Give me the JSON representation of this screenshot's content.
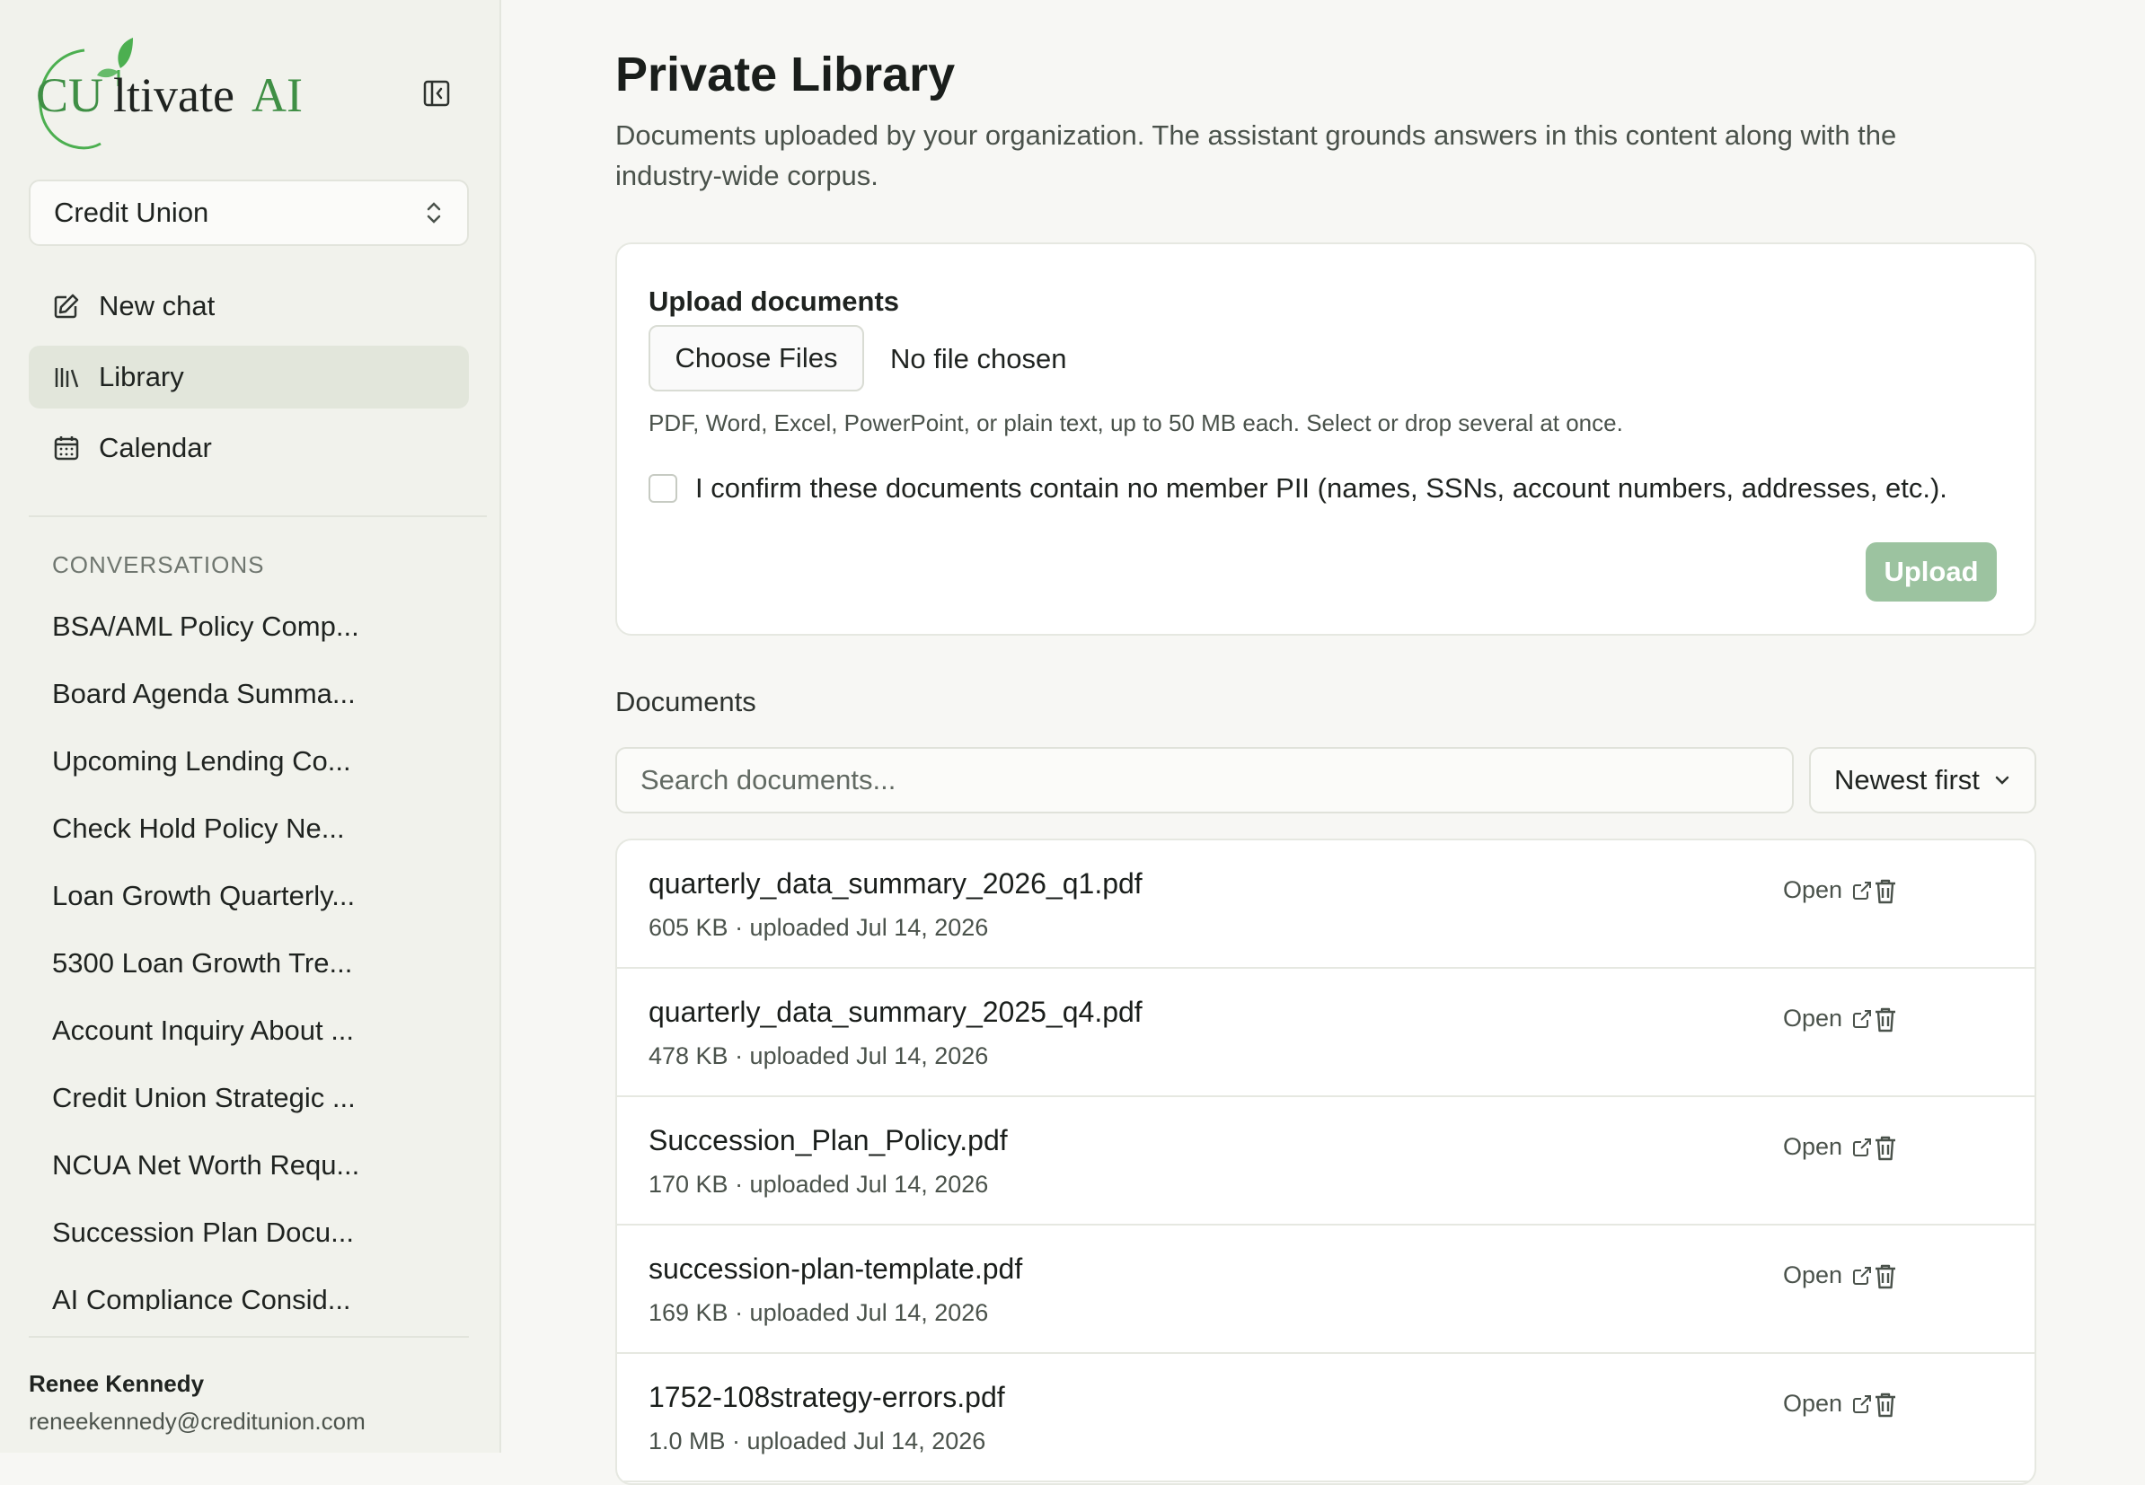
{
  "sidebar": {
    "logo_text": "CUltivateAI",
    "workspace": "Credit Union",
    "nav": [
      {
        "label": "New chat",
        "icon": "edit-icon"
      },
      {
        "label": "Library",
        "icon": "library-icon",
        "active": true
      },
      {
        "label": "Calendar",
        "icon": "calendar-icon"
      }
    ],
    "conversations_header": "CONVERSATIONS",
    "conversations": [
      "BSA/AML Policy Comp...",
      "Board Agenda Summa...",
      "Upcoming Lending Co...",
      "Check Hold Policy Ne...",
      "Loan Growth Quarterly...",
      "5300 Loan Growth Tre...",
      "Account Inquiry About ...",
      "Credit Union Strategic ...",
      "NCUA Net Worth Requ...",
      "Succession Plan Docu...",
      "AI Compliance Consid..."
    ],
    "user": {
      "name": "Renee Kennedy",
      "email": "reneekennedy@creditunion.com"
    }
  },
  "main": {
    "title": "Private Library",
    "description": "Documents uploaded by your organization. The assistant grounds answers in this content along with the industry-wide corpus.",
    "upload": {
      "title": "Upload documents",
      "choose_label": "Choose Files",
      "no_file": "No file chosen",
      "hint": "PDF, Word, Excel, PowerPoint, or plain text, up to 50 MB each. Select or drop several at once.",
      "confirm": "I confirm these documents contain no member PII (names, SSNs, account numbers, addresses, etc.).",
      "button": "Upload"
    },
    "documents": {
      "header": "Documents",
      "search_placeholder": "Search documents...",
      "sort": "Newest first",
      "open_label": "Open",
      "items": [
        {
          "name": "quarterly_data_summary_2026_q1.pdf",
          "meta": "605 KB · uploaded Jul 14, 2026"
        },
        {
          "name": "quarterly_data_summary_2025_q4.pdf",
          "meta": "478 KB · uploaded Jul 14, 2026"
        },
        {
          "name": "Succession_Plan_Policy.pdf",
          "meta": "170 KB · uploaded Jul 14, 2026"
        },
        {
          "name": "succession-plan-template.pdf",
          "meta": "169 KB · uploaded Jul 14, 2026"
        },
        {
          "name": "1752-108strategy-errors.pdf",
          "meta": "1.0 MB · uploaded Jul 14, 2026"
        }
      ]
    }
  },
  "colors": {
    "accent_green": "#3f8f45",
    "leaf_green": "#4caf50",
    "upload_button": "#9cc3a0",
    "active_nav": "#e2e6db"
  }
}
